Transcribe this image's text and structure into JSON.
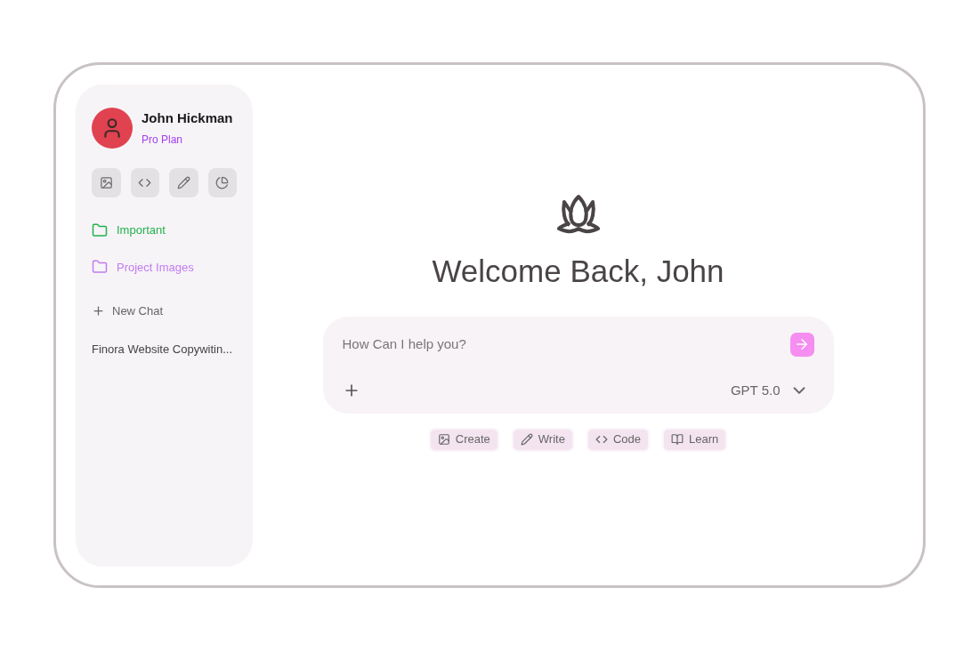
{
  "user": {
    "name": "John Hickman",
    "plan": "Pro Plan"
  },
  "tools": [
    {
      "kind": "image"
    },
    {
      "kind": "code"
    },
    {
      "kind": "pen"
    },
    {
      "kind": "chart"
    }
  ],
  "folders": [
    {
      "label": "Important",
      "color": "#22b14c"
    },
    {
      "label": "Project Images",
      "color": "#c07cf0"
    }
  ],
  "new_chat": "New Chat",
  "chats": [
    "Finora Website Copywitin..."
  ],
  "greeting": "Welcome Back, John",
  "prompt": {
    "placeholder": "How Can I help you?",
    "model": "GPT 5.0"
  },
  "quick_actions": [
    {
      "kind": "image",
      "label": "Create"
    },
    {
      "kind": "pen",
      "label": "Write"
    },
    {
      "kind": "code",
      "label": "Code"
    },
    {
      "kind": "book",
      "label": "Learn"
    }
  ]
}
